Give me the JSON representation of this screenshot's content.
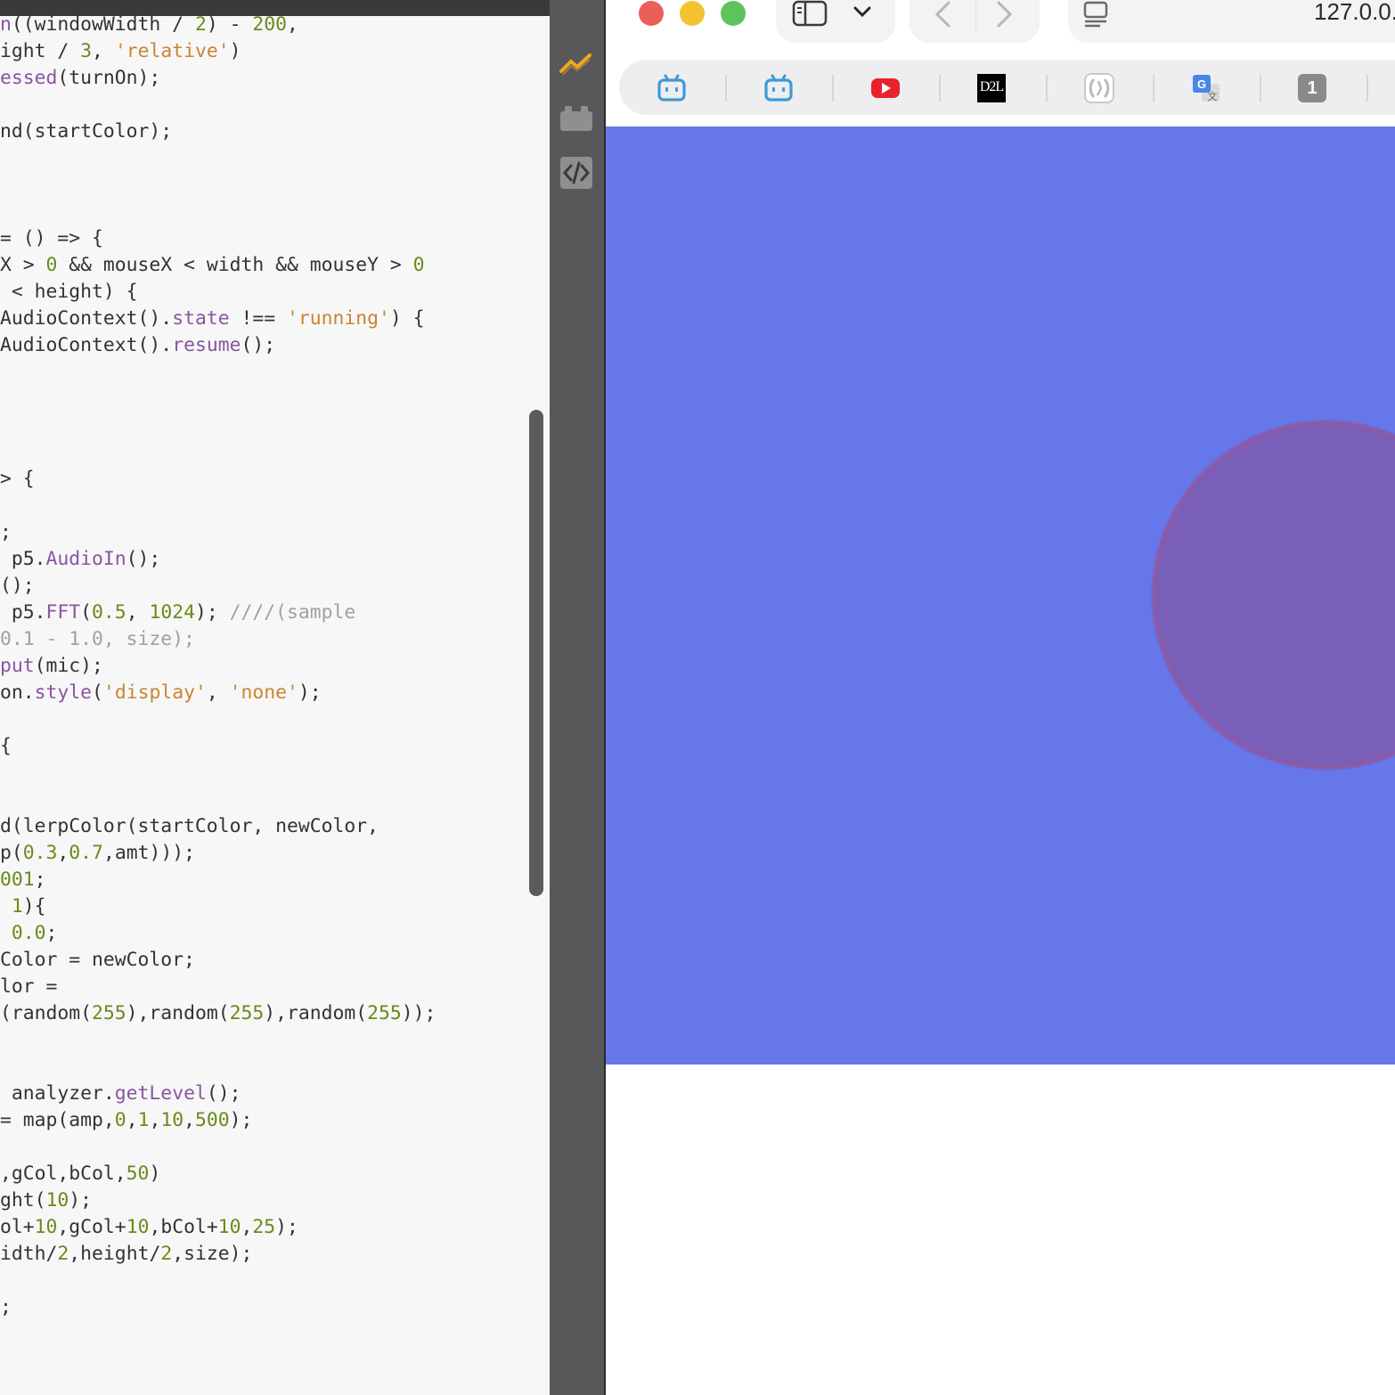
{
  "editor": {
    "lines": [
      [
        [
          "tk-fn",
          "n"
        ],
        [
          "tk-plain",
          "((windowWidth / "
        ],
        [
          "tk-num",
          "2"
        ],
        [
          "tk-plain",
          ") - "
        ],
        [
          "tk-num",
          "200"
        ],
        [
          "tk-plain",
          ","
        ]
      ],
      [
        [
          "tk-plain",
          "ight / "
        ],
        [
          "tk-num",
          "3"
        ],
        [
          "tk-plain",
          ", "
        ],
        [
          "tk-str",
          "'relative'"
        ],
        [
          "tk-plain",
          ")"
        ]
      ],
      [
        [
          "tk-fn",
          "essed"
        ],
        [
          "tk-plain",
          "(turnOn);"
        ]
      ],
      [],
      [
        [
          "tk-plain",
          "nd(startColor);"
        ]
      ],
      [],
      [],
      [],
      [
        [
          "tk-plain",
          "= () => {"
        ]
      ],
      [
        [
          "tk-plain",
          "X > "
        ],
        [
          "tk-num",
          "0"
        ],
        [
          "tk-plain",
          " && mouseX < width && mouseY > "
        ],
        [
          "tk-num",
          "0"
        ]
      ],
      [
        [
          "tk-plain",
          " < height) {"
        ]
      ],
      [
        [
          "tk-plain",
          "AudioContext()."
        ],
        [
          "tk-fn",
          "state"
        ],
        [
          "tk-plain",
          " !== "
        ],
        [
          "tk-str",
          "'running'"
        ],
        [
          "tk-plain",
          ") {"
        ]
      ],
      [
        [
          "tk-plain",
          "AudioContext()."
        ],
        [
          "tk-fn",
          "resume"
        ],
        [
          "tk-plain",
          "();"
        ]
      ],
      [],
      [],
      [],
      [],
      [
        [
          "tk-plain",
          "> {"
        ]
      ],
      [],
      [
        [
          "tk-plain",
          ";"
        ]
      ],
      [
        [
          "tk-plain",
          " p5."
        ],
        [
          "tk-fn",
          "AudioIn"
        ],
        [
          "tk-plain",
          "();"
        ]
      ],
      [
        [
          "tk-plain",
          "();"
        ]
      ],
      [
        [
          "tk-plain",
          " p5."
        ],
        [
          "tk-fn",
          "FFT"
        ],
        [
          "tk-plain",
          "("
        ],
        [
          "tk-num",
          "0.5"
        ],
        [
          "tk-plain",
          ", "
        ],
        [
          "tk-num",
          "1024"
        ],
        [
          "tk-plain",
          "); "
        ],
        [
          "tk-cmt",
          "////(sample"
        ]
      ],
      [
        [
          "tk-cmt",
          "0.1 - 1.0, size);"
        ]
      ],
      [
        [
          "tk-fn",
          "put"
        ],
        [
          "tk-plain",
          "(mic);"
        ]
      ],
      [
        [
          "tk-plain",
          "on."
        ],
        [
          "tk-fn",
          "style"
        ],
        [
          "tk-plain",
          "("
        ],
        [
          "tk-str",
          "'display'"
        ],
        [
          "tk-plain",
          ", "
        ],
        [
          "tk-str",
          "'none'"
        ],
        [
          "tk-plain",
          ");"
        ]
      ],
      [],
      [
        [
          "tk-plain",
          "{"
        ]
      ],
      [],
      [],
      [
        [
          "tk-plain",
          "d(lerpColor(startColor, newColor,"
        ]
      ],
      [
        [
          "tk-plain",
          "p("
        ],
        [
          "tk-num",
          "0.3"
        ],
        [
          "tk-plain",
          ","
        ],
        [
          "tk-num",
          "0.7"
        ],
        [
          "tk-plain",
          ",amt)));"
        ]
      ],
      [
        [
          "tk-num",
          "001"
        ],
        [
          "tk-plain",
          ";"
        ]
      ],
      [
        [
          "tk-plain",
          " "
        ],
        [
          "tk-num",
          "1"
        ],
        [
          "tk-plain",
          "){"
        ]
      ],
      [
        [
          "tk-plain",
          " "
        ],
        [
          "tk-num",
          "0.0"
        ],
        [
          "tk-plain",
          ";"
        ]
      ],
      [
        [
          "tk-plain",
          "Color = newColor;"
        ]
      ],
      [
        [
          "tk-plain",
          "lor ="
        ]
      ],
      [
        [
          "tk-plain",
          "(random("
        ],
        [
          "tk-num",
          "255"
        ],
        [
          "tk-plain",
          "),random("
        ],
        [
          "tk-num",
          "255"
        ],
        [
          "tk-plain",
          "),random("
        ],
        [
          "tk-num",
          "255"
        ],
        [
          "tk-plain",
          "));"
        ]
      ],
      [],
      [],
      [
        [
          "tk-plain",
          " analyzer."
        ],
        [
          "tk-fn",
          "getLevel"
        ],
        [
          "tk-plain",
          "();"
        ]
      ],
      [
        [
          "tk-plain",
          "= map(amp,"
        ],
        [
          "tk-num",
          "0"
        ],
        [
          "tk-plain",
          ","
        ],
        [
          "tk-num",
          "1"
        ],
        [
          "tk-plain",
          ","
        ],
        [
          "tk-num",
          "10"
        ],
        [
          "tk-plain",
          ","
        ],
        [
          "tk-num",
          "500"
        ],
        [
          "tk-plain",
          ");"
        ]
      ],
      [],
      [
        [
          "tk-plain",
          ",gCol,bCol,"
        ],
        [
          "tk-num",
          "50"
        ],
        [
          "tk-plain",
          ")"
        ]
      ],
      [
        [
          "tk-plain",
          "ght("
        ],
        [
          "tk-num",
          "10"
        ],
        [
          "tk-plain",
          ");"
        ]
      ],
      [
        [
          "tk-plain",
          "ol+"
        ],
        [
          "tk-num",
          "10"
        ],
        [
          "tk-plain",
          ",gCol+"
        ],
        [
          "tk-num",
          "10"
        ],
        [
          "tk-plain",
          ",bCol+"
        ],
        [
          "tk-num",
          "10"
        ],
        [
          "tk-plain",
          ","
        ],
        [
          "tk-num",
          "25"
        ],
        [
          "tk-plain",
          ");"
        ]
      ],
      [
        [
          "tk-plain",
          "idth/"
        ],
        [
          "tk-num",
          "2"
        ],
        [
          "tk-plain",
          ",height/"
        ],
        [
          "tk-num",
          "2"
        ],
        [
          "tk-plain",
          ",size);"
        ]
      ],
      [],
      [
        [
          "tk-plain",
          ";"
        ]
      ]
    ]
  },
  "sidebar": {
    "icons": [
      "console-icon",
      "plugins-icon",
      "code-icon"
    ]
  },
  "browser": {
    "address": "127.0.0.",
    "favorites": [
      {
        "name": "bilibili-icon",
        "label": ""
      },
      {
        "name": "bilibili-icon",
        "label": ""
      },
      {
        "name": "youtube-icon",
        "label": ""
      },
      {
        "name": "d2l-icon",
        "label": "D2L"
      },
      {
        "name": "grammarly-icon",
        "label": ""
      },
      {
        "name": "google-translate-icon",
        "label": ""
      },
      {
        "name": "tab-count-icon",
        "label": "1"
      }
    ],
    "canvas_background": "#6677ea",
    "circle_color": "#7a5fb9"
  }
}
